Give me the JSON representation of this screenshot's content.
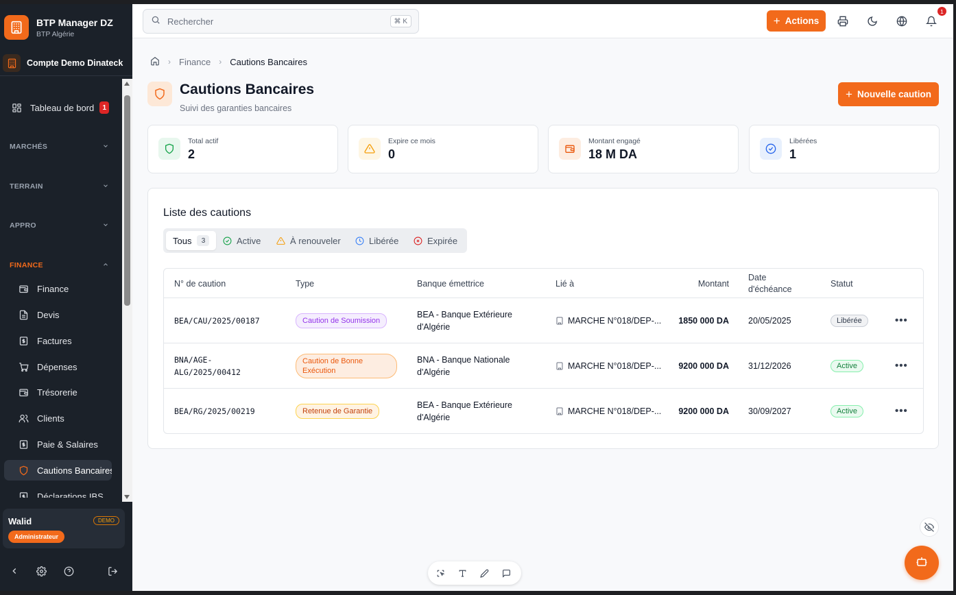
{
  "brand": {
    "title": "BTP Manager DZ",
    "subtitle": "BTP Algérie",
    "icon": "building-icon"
  },
  "account": {
    "name": "Compte Demo Dinateck"
  },
  "sidebar": {
    "dashboard": {
      "label": "Tableau de bord",
      "badge": "1"
    },
    "sections": [
      {
        "label": "MARCHÉS"
      },
      {
        "label": "TERRAIN"
      },
      {
        "label": "APPRO"
      },
      {
        "label": "FINANCE"
      }
    ],
    "finance_items": [
      {
        "label": "Finance"
      },
      {
        "label": "Devis"
      },
      {
        "label": "Factures"
      },
      {
        "label": "Dépenses"
      },
      {
        "label": "Trésorerie"
      },
      {
        "label": "Clients"
      },
      {
        "label": "Paie & Salaires"
      },
      {
        "label": "Cautions Bancaires"
      },
      {
        "label": "Déclarations IBS"
      }
    ]
  },
  "user": {
    "name": "Walid",
    "tag": "DEMO",
    "role": "Administrateur"
  },
  "topbar": {
    "search_placeholder": "Rechercher",
    "shortcut": "⌘ K",
    "actions_label": "Actions",
    "notification_count": "1"
  },
  "breadcrumb": {
    "parent": "Finance",
    "current": "Cautions Bancaires"
  },
  "page": {
    "title": "Cautions Bancaires",
    "subtitle": "Suivi des garanties bancaires",
    "new_button": "Nouvelle caution"
  },
  "stats": [
    {
      "label": "Total actif",
      "value": "2",
      "color": "#16a34a"
    },
    {
      "label": "Expire ce mois",
      "value": "0",
      "color": "#f59e0b"
    },
    {
      "label": "Montant engagé",
      "value": "18 M DA",
      "color": "#ea580c"
    },
    {
      "label": "Libérées",
      "value": "1",
      "color": "#2563eb"
    }
  ],
  "list": {
    "title": "Liste des cautions",
    "filters": [
      {
        "label": "Tous",
        "count": "3"
      },
      {
        "label": "Active"
      },
      {
        "label": "À renouveler"
      },
      {
        "label": "Libérée"
      },
      {
        "label": "Expirée"
      }
    ],
    "columns": {
      "number": "N° de caution",
      "type": "Type",
      "bank": "Banque émettrice",
      "linked": "Lié à",
      "amount": "Montant",
      "due_1": "Date",
      "due_2": "d'échéance",
      "status": "Statut"
    },
    "rows": [
      {
        "number_1": "BEA/CAU/2025/00187",
        "number_2": "",
        "type_1": "Caution de Soumission",
        "type_2": "",
        "bank_1": "BEA - Banque Extérieure",
        "bank_2": "d'Algérie",
        "linked": "MARCHE N°018/DEP-...",
        "amount": "1850 000 DA",
        "due": "20/05/2025",
        "status": "Libérée"
      },
      {
        "number_1": "BNA/AGE-",
        "number_2": "ALG/2025/00412",
        "type_1": "Caution de Bonne",
        "type_2": "Exécution",
        "bank_1": "BNA - Banque Nationale",
        "bank_2": "d'Algérie",
        "linked": "MARCHE N°018/DEP-...",
        "amount": "9200 000 DA",
        "due": "31/12/2026",
        "status": "Active"
      },
      {
        "number_1": "BEA/RG/2025/00219",
        "number_2": "",
        "type_1": "Retenue de Garantie",
        "type_2": "",
        "bank_1": "BEA - Banque Extérieure",
        "bank_2": "d'Algérie",
        "linked": "MARCHE N°018/DEP-...",
        "amount": "9200 000 DA",
        "due": "30/09/2027",
        "status": "Active"
      }
    ]
  },
  "colors": {
    "accent": "#f26a1b",
    "sidebar_bg": "#1b2129",
    "danger": "#dc2626"
  }
}
